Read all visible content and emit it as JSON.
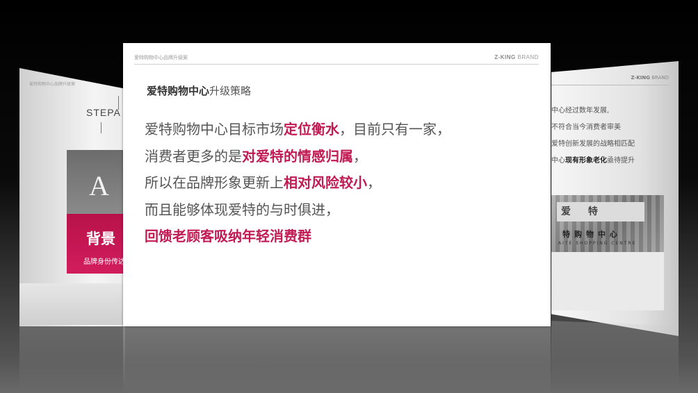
{
  "left_slide": {
    "header": "爱特购物中心品牌升级案",
    "stepa": "STEPA",
    "letter": "A",
    "card_title": "背景",
    "card_subtitle": "品牌身份传达"
  },
  "right_slide": {
    "brand_bold": "Z-KING",
    "brand_rest": " BRAND",
    "lines": [
      {
        "text": "中心经过数年发展,",
        "em": ""
      },
      {
        "text": "不符合当今消费者审美",
        "em": ""
      },
      {
        "text": "爱特创新发展的战略相匹配",
        "em": ""
      },
      {
        "text": "中心",
        "em": "现有形象老化",
        "tail": "亟待提升"
      }
    ],
    "photo_sign_top": "爱 特",
    "photo_sign_main": "特购物中心",
    "photo_sign_small": "AITE SHOPPING CENTRE"
  },
  "main_slide": {
    "header_left": "爱特购物中心品牌升级案",
    "header_right_bold": "Z-KING",
    "header_right_rest": " BRAND",
    "section_title_bold": "爱特购物中心",
    "section_title_rest": "升级策略",
    "lines": [
      {
        "pre": "爱特购物中心目标市场",
        "em": "定位衡水",
        "post": "，目前只有一家，"
      },
      {
        "pre": "消费者更多的是",
        "em": "对爱特的情感归属",
        "post": "，"
      },
      {
        "pre": "所以在品牌形象更新上",
        "em": "相对风险较小",
        "post": "，"
      },
      {
        "pre": "而且能够体现爱特的与时俱进，",
        "em": "",
        "post": ""
      },
      {
        "pre": "",
        "em": "回馈老顾客吸纳年轻消费群",
        "post": ""
      }
    ]
  },
  "colors": {
    "accent": "#c21a52",
    "background": "#000000",
    "slide": "#ffffff"
  }
}
